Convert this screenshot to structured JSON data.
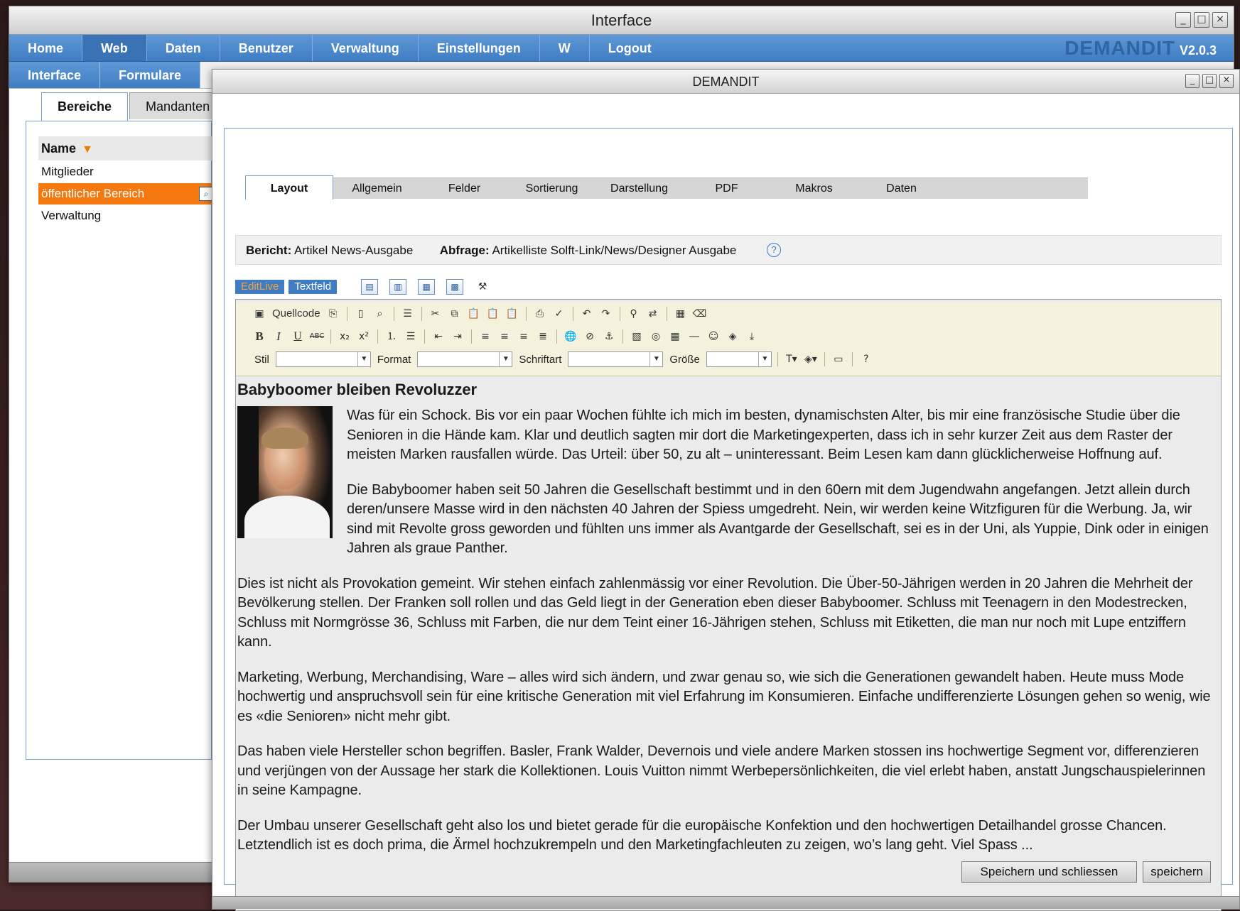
{
  "outer_window": {
    "title": "Interface",
    "controls": [
      "_",
      "□",
      "×"
    ]
  },
  "menubar": {
    "items": [
      "Home",
      "Web",
      "Daten",
      "Benutzer",
      "Verwaltung",
      "Einstellungen",
      "W",
      "Logout"
    ],
    "active": "Web",
    "brand": "DEMANDIT",
    "version": "V2.0.3"
  },
  "submenu": {
    "items": [
      "Interface",
      "Formulare"
    ]
  },
  "left_panel": {
    "tabs": [
      "Bereiche",
      "Mandanten"
    ],
    "column_header": "Name",
    "rows": [
      "Mitglieder",
      "öffentlicher Bereich",
      "Verwaltung"
    ],
    "selected_row": "öffentlicher Bereich"
  },
  "inner_window": {
    "title": "DEMANDIT",
    "controls": [
      "_",
      "□",
      "×"
    ],
    "tabs": [
      "Layout",
      "Allgemein",
      "Felder",
      "Sortierung",
      "Darstellung",
      "PDF",
      "Makros",
      "Daten"
    ],
    "active_tab": "Layout",
    "info": {
      "bericht_label": "Bericht:",
      "bericht_value": "Artikel News-Ausgabe",
      "abfrage_label": "Abfrage:",
      "abfrage_value": "Artikelliste Solft-Link/News/Designer Ausgabe"
    },
    "modes": [
      "EditLive",
      "Textfeld"
    ],
    "toolbar": {
      "source_label": "Quellcode",
      "stil_label": "Stil",
      "format_label": "Format",
      "schriftart_label": "Schriftart",
      "groesse_label": "Größe"
    },
    "article": {
      "title": "Babyboomer bleiben Revoluzzer",
      "paragraphs": [
        "Was für ein Schock. Bis vor ein paar Wochen fühlte ich mich im besten, dynamischsten Alter, bis mir eine französische Studie über die Senioren in die Hände kam. Klar und deutlich sagten mir dort die Marketingexperten, dass ich in sehr kurzer Zeit aus dem Raster der meisten Marken rausfallen würde. Das Urteil: über 50, zu alt – uninteressant. Beim Lesen kam dann glücklicherweise Hoffnung auf.",
        "Die Babyboomer haben seit 50 Jahren die Gesellschaft bestimmt und in den 60ern mit dem Jugendwahn angefangen. Jetzt allein durch deren/unsere Masse wird in den nächsten 40 Jahren der Spiess umgedreht. Nein, wir werden keine Witzfiguren für die Werbung. Ja, wir sind mit Revolte gross geworden und fühlten uns immer als Avantgarde der Gesellschaft, sei es in der Uni, als Yuppie, Dink oder in einigen Jahren als graue Panther.",
        "Dies ist nicht als Provokation gemeint. Wir stehen einfach zahlenmässig vor einer Revolution. Die Über-50-Jährigen werden in 20 Jahren die Mehrheit der Bevölkerung stellen. Der Franken soll rollen und das Geld liegt in der Generation eben dieser Babyboomer. Schluss mit Teenagern in den Modestrecken, Schluss mit Normgrösse 36, Schluss mit Farben, die nur dem Teint einer 16-Jährigen stehen, Schluss mit Etiketten, die man nur noch mit Lupe entziffern kann.",
        "Marketing, Werbung, Merchandising, Ware – alles wird sich ändern, und zwar genau so, wie sich die Generationen gewandelt haben. Heute muss Mode hochwertig und anspruchsvoll sein für eine kritische Generation mit viel Erfahrung im Konsumieren. Einfache undifferenzierte Lösungen gehen so wenig, wie es «die Senioren» nicht mehr gibt.",
        "Das haben viele Hersteller schon begriffen. Basler, Frank Walder, Devernois und viele andere Marken stossen ins hochwertige Segment vor, differenzieren und verjüngen von der Aussage her stark die Kollektionen. Louis Vuitton nimmt Werbepersönlichkeiten, die viel erlebt haben, anstatt Jungschauspielerinnen in seine Kampagne.",
        "Der Umbau unserer Gesellschaft geht also los und bietet gerade für die europäische Konfektion und den hochwertigen Detailhandel grosse Chancen. Letztendlich ist es doch prima, die Ärmel hochzukrempeln und den Marketingfachleuten zu zeigen, wo’s lang geht. Viel Spass ..."
      ]
    },
    "buttons": {
      "save_close": "Speichern und schliessen",
      "save": "speichern"
    }
  },
  "colors": {
    "menu_blue": "#3f7cc2",
    "selection_orange": "#f5790e",
    "editor_toolbar_bg": "#f4f2dc"
  }
}
